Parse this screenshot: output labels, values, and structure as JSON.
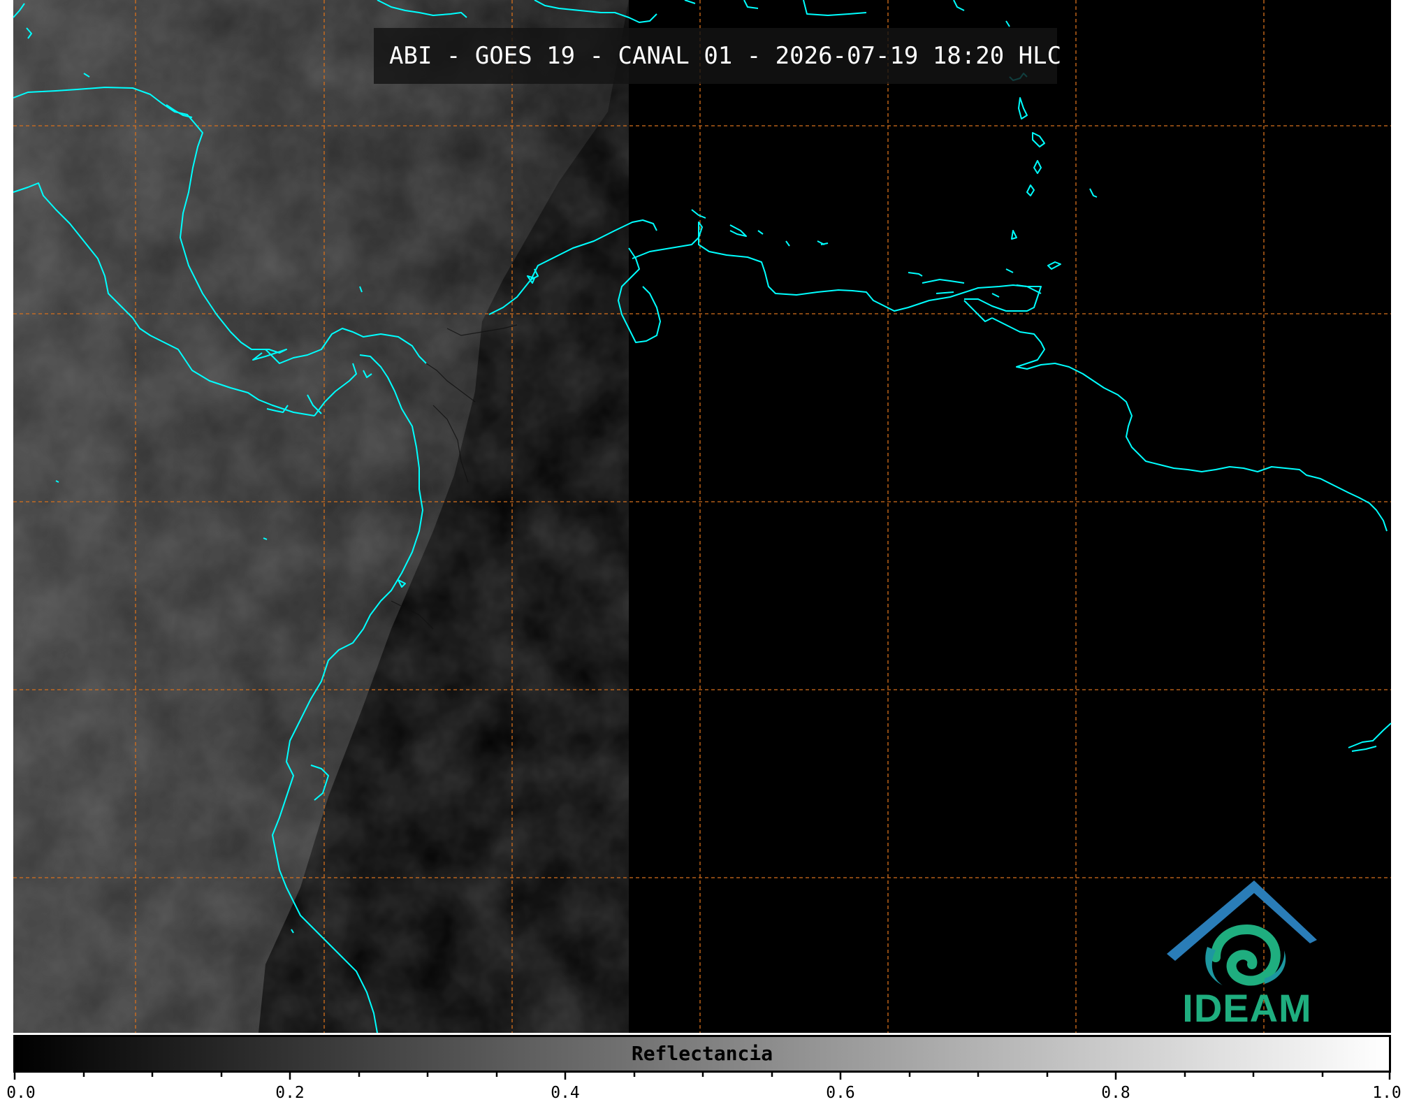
{
  "title": "ABI - GOES 19 - CANAL 01 - 2026-07-19 18:20 HLC",
  "colors": {
    "coastline": "#00ffff",
    "gridline": "#d7701c",
    "background": "#000000",
    "logo_text": "#1fae7f",
    "logo_arc": "#2a7db8"
  },
  "colorbar": {
    "label": "Reflectancia",
    "ticks": [
      "0.0",
      "0.2",
      "0.4",
      "0.6",
      "0.8",
      "1.0"
    ],
    "range": [
      0.0,
      1.0
    ]
  },
  "logo": {
    "text": "IDEAM"
  }
}
